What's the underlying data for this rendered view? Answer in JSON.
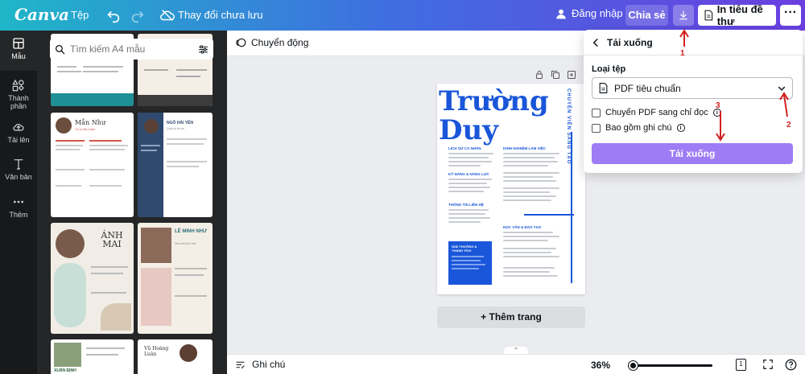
{
  "header": {
    "logo": "Canva",
    "file_menu": "Tệp",
    "save_status": "Thay đổi chưa lưu",
    "login": "Đăng nhập",
    "share": "Chia sẻ",
    "print": "In tiêu đề thư",
    "more": "···"
  },
  "rail": {
    "items": [
      {
        "label": "Mẫu",
        "icon": "template-icon"
      },
      {
        "label": "Thành phần",
        "icon": "elements-icon"
      },
      {
        "label": "Tải lên",
        "icon": "upload-icon"
      },
      {
        "label": "Văn bản",
        "icon": "text-icon"
      },
      {
        "label": "Thêm",
        "icon": "more-icon"
      }
    ]
  },
  "panel": {
    "search_placeholder": "Tìm kiếm A4 mẫu",
    "thumbs": [
      {
        "name": "Mẫn Như",
        "subtitle": "Trợ lý điều hành"
      },
      {
        "name": "NGÔ HẢI YẾN",
        "subtitle": "Quản lý dự án"
      },
      {
        "name": "ÁNH MAI",
        "subtitle": ""
      },
      {
        "name": "LÊ MINH NHƯ",
        "subtitle": "Nhà viết kịch bản"
      },
      {
        "name": "XUÂN ĐỊNH",
        "subtitle": ""
      },
      {
        "name": "Vũ Hoàng Luân",
        "subtitle": ""
      }
    ]
  },
  "canvas": {
    "animate": "Chuyển động",
    "add_page": "+ Thêm trang",
    "doc": {
      "name_line1": "Trường",
      "name_line2": "Duy",
      "title_vertical": "CHUYÊN VIÊN SÁNG TẠO",
      "sections_left": [
        "LỊCH SỬ CÁ NHÂN",
        "KỸ NĂNG & NĂNG LỰC",
        "THÔNG TIN LIÊN HỆ"
      ],
      "sections_right": [
        "KINH NGHIỆM LÀM VIỆC",
        "HỌC VẤN & ĐÀO TẠO"
      ],
      "award_box": "GIẢI THƯỞNG & THÀNH TÍCH"
    }
  },
  "footer": {
    "notes": "Ghi chú",
    "zoom": "36%",
    "zoom_value": 36,
    "page": "1"
  },
  "download_panel": {
    "title": "Tải xuống",
    "file_type_label": "Loại tệp",
    "file_type_value": "PDF tiêu chuẩn",
    "option_flatten": "Chuyển PDF sang chỉ đọc",
    "option_notes": "Bao gồm ghi chú",
    "submit": "Tải xuống"
  },
  "annotations": {
    "a1": "1",
    "a2": "2",
    "a3": "3"
  },
  "colors": {
    "accent": "#9d7cf5",
    "doc_blue": "#1a56d9",
    "annotation": "#d12020"
  }
}
